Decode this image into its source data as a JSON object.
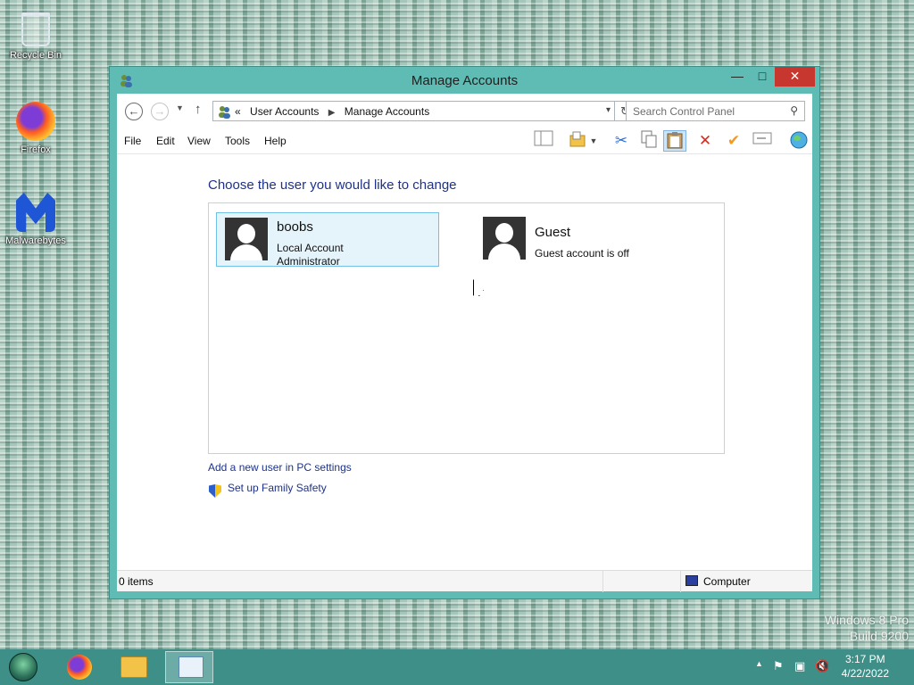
{
  "desktop": {
    "icons": [
      {
        "label": "Recycle Bin"
      },
      {
        "label": "Firefox"
      },
      {
        "label": "Malwarebytes"
      }
    ],
    "watermark": {
      "line1": "Windows 8 Pro",
      "line2": "Build 9200"
    }
  },
  "window": {
    "title": "Manage Accounts",
    "controls": {
      "minimize": "—",
      "maximize": "□",
      "close": "✕"
    },
    "address": {
      "prefix": "«",
      "crumbs": [
        "User Accounts",
        "Manage Accounts"
      ]
    },
    "search": {
      "placeholder": "Search Control Panel"
    },
    "menu": [
      "File",
      "Edit",
      "View",
      "Tools",
      "Help"
    ],
    "heading": "Choose the user you would like to change",
    "users": [
      {
        "name": "boobs",
        "line1": "Local Account",
        "line2": "Administrator",
        "selected": true
      },
      {
        "name": "Guest",
        "line1": "Guest account is off",
        "selected": false
      }
    ],
    "links": {
      "add_user": "Add a new user in PC settings",
      "family_safety": "Set up Family Safety"
    },
    "status": {
      "items": "0 items",
      "location": "Computer"
    }
  },
  "taskbar": {
    "clock": {
      "time": "3:17 PM",
      "date": "4/22/2022"
    }
  },
  "icons": {
    "back": "back-arrow-icon",
    "forward": "forward-arrow-icon",
    "up": "up-arrow-icon",
    "refresh": "refresh-icon",
    "search": "magnifier-icon",
    "shield": "uac-shield-icon"
  },
  "colors": {
    "window_frame": "#5ebcb4",
    "close_button": "#c7372f",
    "link_text": "#1e3287",
    "selection_bg": "#e5f3fb",
    "selection_border": "#70c0e7",
    "taskbar": "#3d8f88"
  }
}
